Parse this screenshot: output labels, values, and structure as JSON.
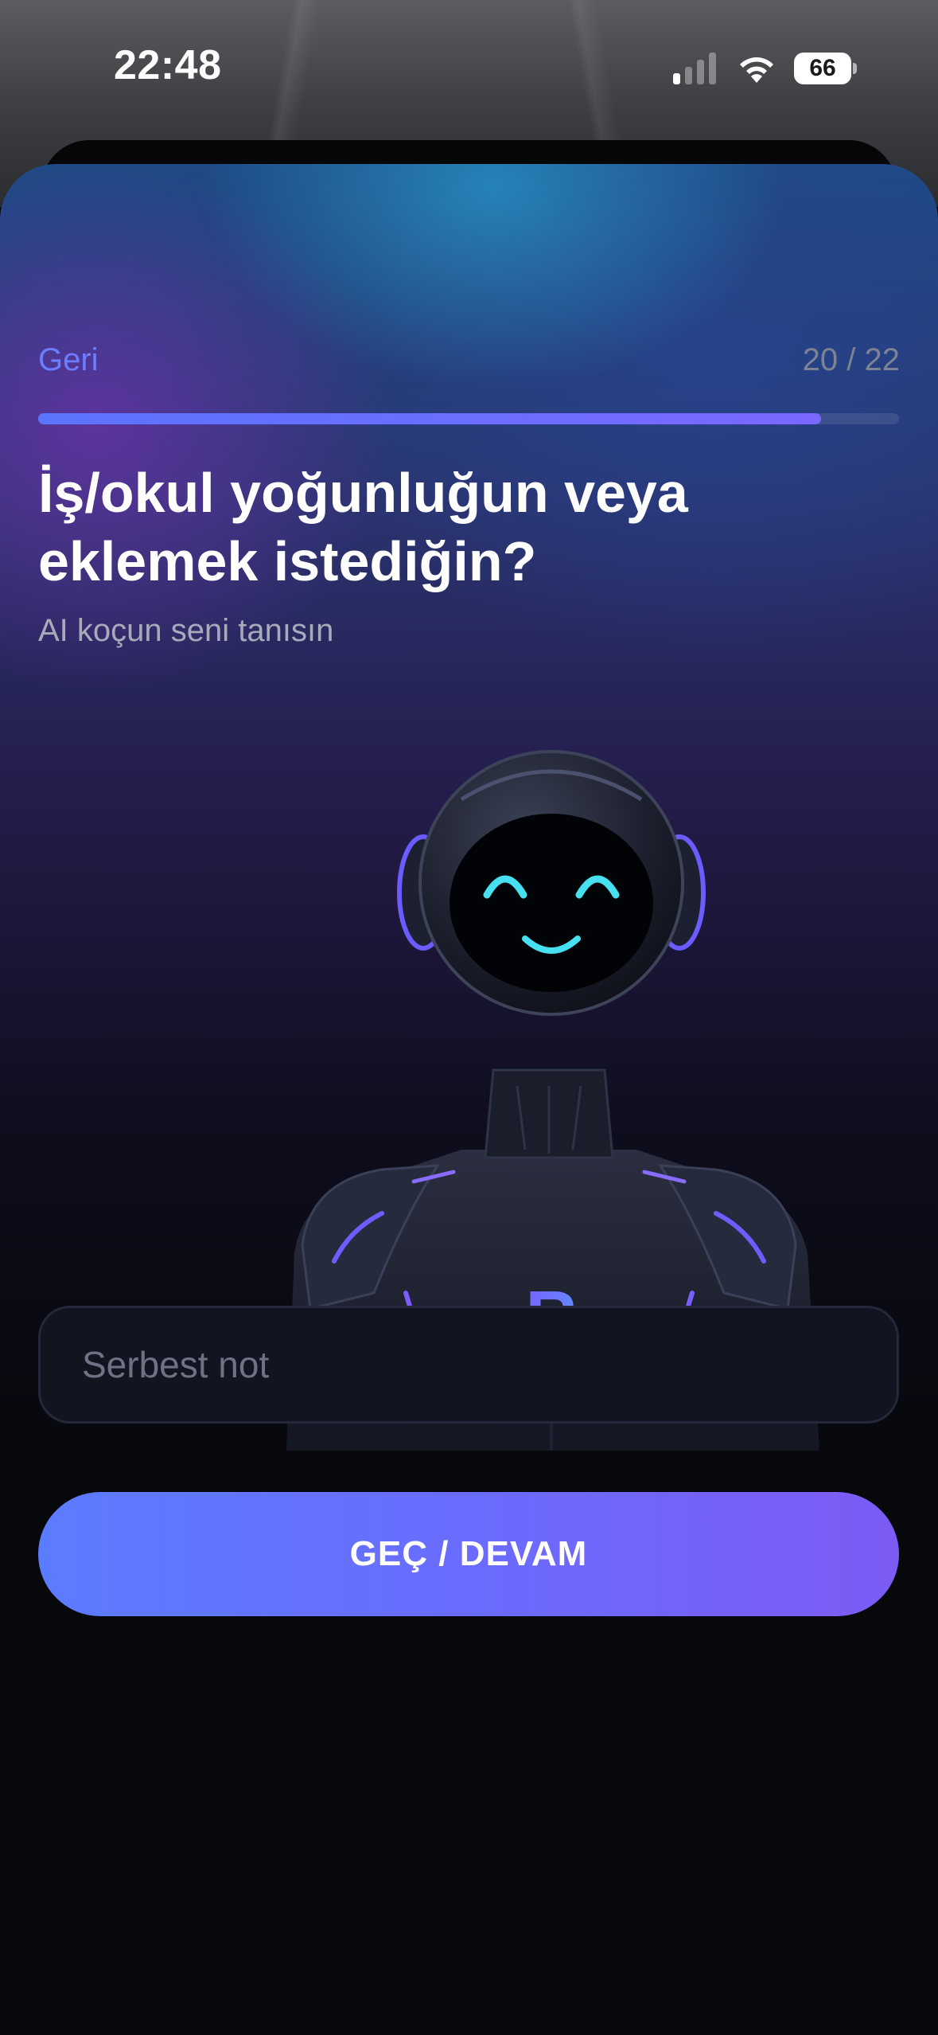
{
  "status_bar": {
    "time": "22:48",
    "battery": "66",
    "icons": [
      "cellular-signal-icon",
      "wifi-icon",
      "battery-icon"
    ]
  },
  "nav": {
    "back_label": "Geri",
    "step_counter": "20 / 22"
  },
  "progress": {
    "current": 20,
    "total": 22
  },
  "question": {
    "title": "İş/okul yoğunluğun veya eklemek istediğin?",
    "subtitle": "AI koçun seni tanısın"
  },
  "mascot": {
    "icon": "robot-coach-mascot",
    "chest_letter": "R"
  },
  "note_input": {
    "value": "",
    "placeholder": "Serbest not"
  },
  "actions": {
    "continue_label": "GEÇ / DEVAM"
  },
  "colors": {
    "accent": "#6e7dff",
    "button_gradient_start": "#5b7cff",
    "button_gradient_end": "#7d5bf5",
    "background": "#07080c",
    "visor_glow": "#46e0f0"
  }
}
